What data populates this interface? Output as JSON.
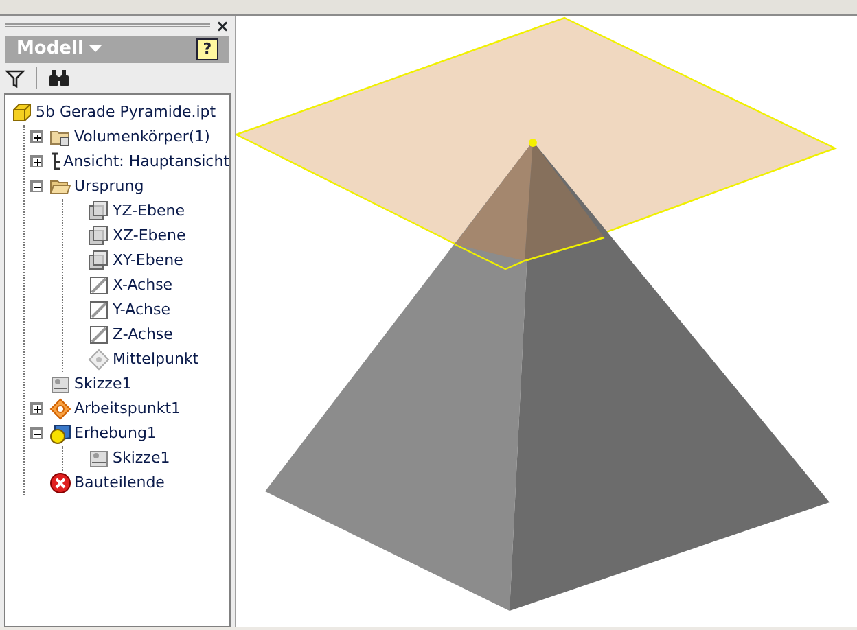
{
  "panel": {
    "close": "×",
    "title": "Modell",
    "help": "?"
  },
  "tree": [
    {
      "label": "5b Gerade Pyramide.ipt",
      "kind": "part",
      "children": [
        {
          "label": "Volumenkörper(1)",
          "kind": "bodies",
          "expanded": false
        },
        {
          "label": "Ansicht: Hauptansicht",
          "kind": "view",
          "expanded": false
        },
        {
          "label": "Ursprung",
          "kind": "origin",
          "expanded": true,
          "children": [
            {
              "label": "YZ-Ebene",
              "kind": "plane"
            },
            {
              "label": "XZ-Ebene",
              "kind": "plane"
            },
            {
              "label": "XY-Ebene",
              "kind": "plane"
            },
            {
              "label": "X-Achse",
              "kind": "axis"
            },
            {
              "label": "Y-Achse",
              "kind": "axis"
            },
            {
              "label": "Z-Achse",
              "kind": "axis"
            },
            {
              "label": "Mittelpunkt",
              "kind": "point"
            }
          ]
        },
        {
          "label": "Skizze1",
          "kind": "sketch"
        },
        {
          "label": "Arbeitspunkt1",
          "kind": "workpoint",
          "expanded": false
        },
        {
          "label": "Erhebung1",
          "kind": "loft",
          "expanded": true,
          "children": [
            {
              "label": "Skizze1",
              "kind": "sketch"
            }
          ]
        },
        {
          "label": "Bauteilende",
          "kind": "end"
        }
      ]
    }
  ]
}
